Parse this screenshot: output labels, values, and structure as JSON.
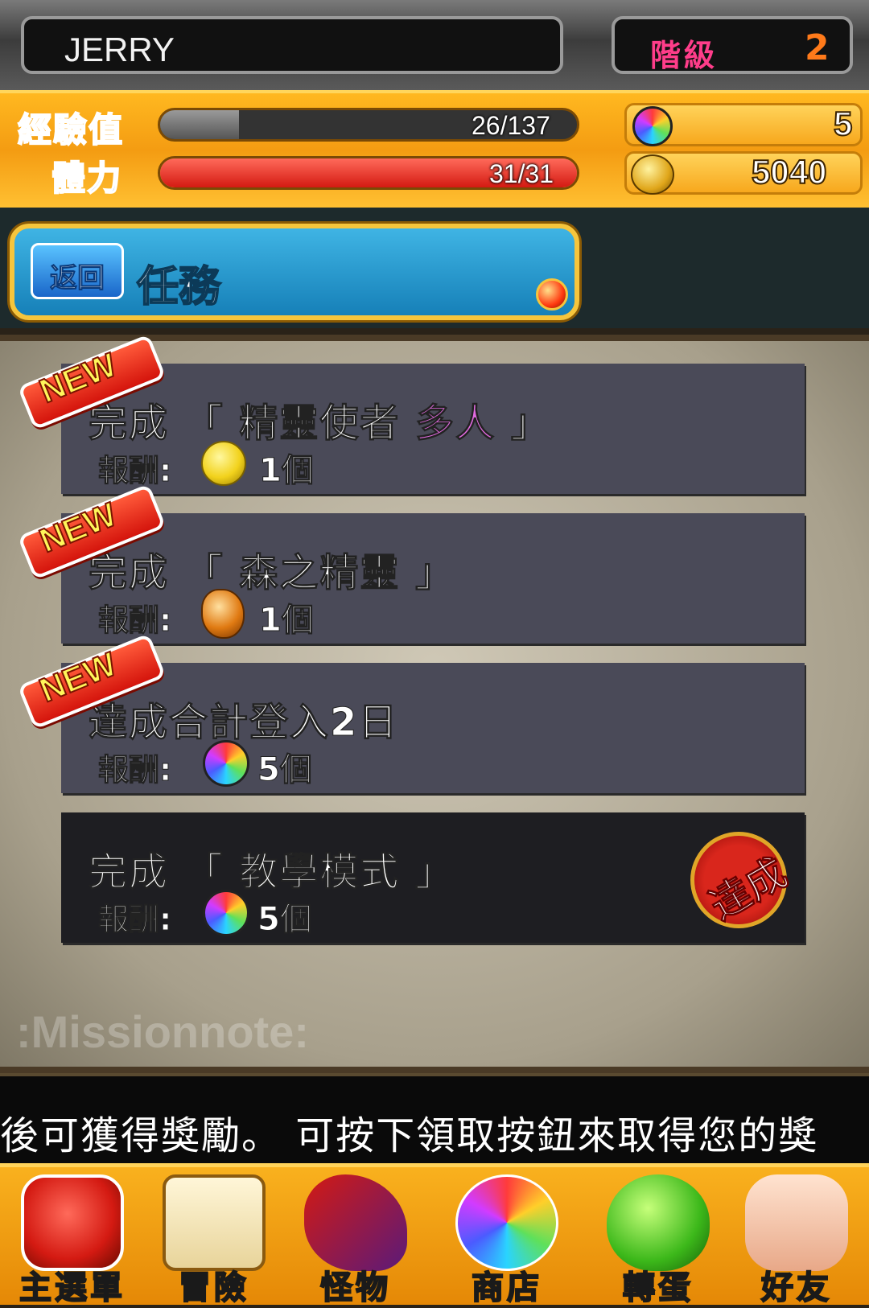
{
  "player": {
    "name": "JERRY",
    "rank_label": "階級",
    "rank_value": "2"
  },
  "status": {
    "exp_label": "經驗值",
    "exp_text": "26/137",
    "exp_fraction": 0.19,
    "stamina_label": "體力",
    "stamina_text": "31/31",
    "stamina_fraction": 1.0,
    "gems": "5",
    "coins": "5040"
  },
  "header": {
    "back_label": "返回",
    "title": "任務"
  },
  "missions": [
    {
      "is_new": true,
      "line_prefix": "完成 「 精靈使者 ",
      "highlight": "多人",
      "line_suffix": " 」",
      "reward_label": "報酬:",
      "reward_icon": "yellow-gem-icon",
      "reward_count": "1個",
      "completed": false
    },
    {
      "is_new": true,
      "line_prefix": "完成 「 森之精靈 」",
      "highlight": "",
      "line_suffix": "",
      "reward_label": "報酬:",
      "reward_icon": "amber-gem-icon",
      "reward_count": "1個",
      "completed": false
    },
    {
      "is_new": true,
      "line_prefix": "達成合計登入2日",
      "highlight": "",
      "line_suffix": "",
      "reward_label": "報酬:",
      "reward_icon": "rainbow-orb-icon",
      "reward_count": "5個",
      "completed": false
    },
    {
      "is_new": false,
      "line_prefix": "完成 「 教學模式 」",
      "highlight": "",
      "line_suffix": "",
      "reward_label": "報酬:",
      "reward_icon": "rainbow-orb-icon",
      "reward_count": "5個",
      "completed": true
    }
  ],
  "new_badge": "NEW",
  "done_stamp": "達成",
  "watermark": ":Missionnote:",
  "ticker": "後可獲得獎勵。 可按下領取按鈕來取得您的獎",
  "nav": [
    {
      "label": "主選單",
      "icon": "red-demon-icon"
    },
    {
      "label": "冒險",
      "icon": "scroll-icon"
    },
    {
      "label": "怪物",
      "icon": "dragon-icon"
    },
    {
      "label": "商店",
      "icon": "rainbow-orb-icon"
    },
    {
      "label": "轉蛋",
      "icon": "egg-icon"
    },
    {
      "label": "好友",
      "icon": "handshake-icon"
    }
  ],
  "colors": {
    "accent_gold": "#f49c12",
    "title_blue": "#1680b8",
    "highlight_pink": "#e16ae0",
    "rank_pink": "#ff3d8a"
  }
}
